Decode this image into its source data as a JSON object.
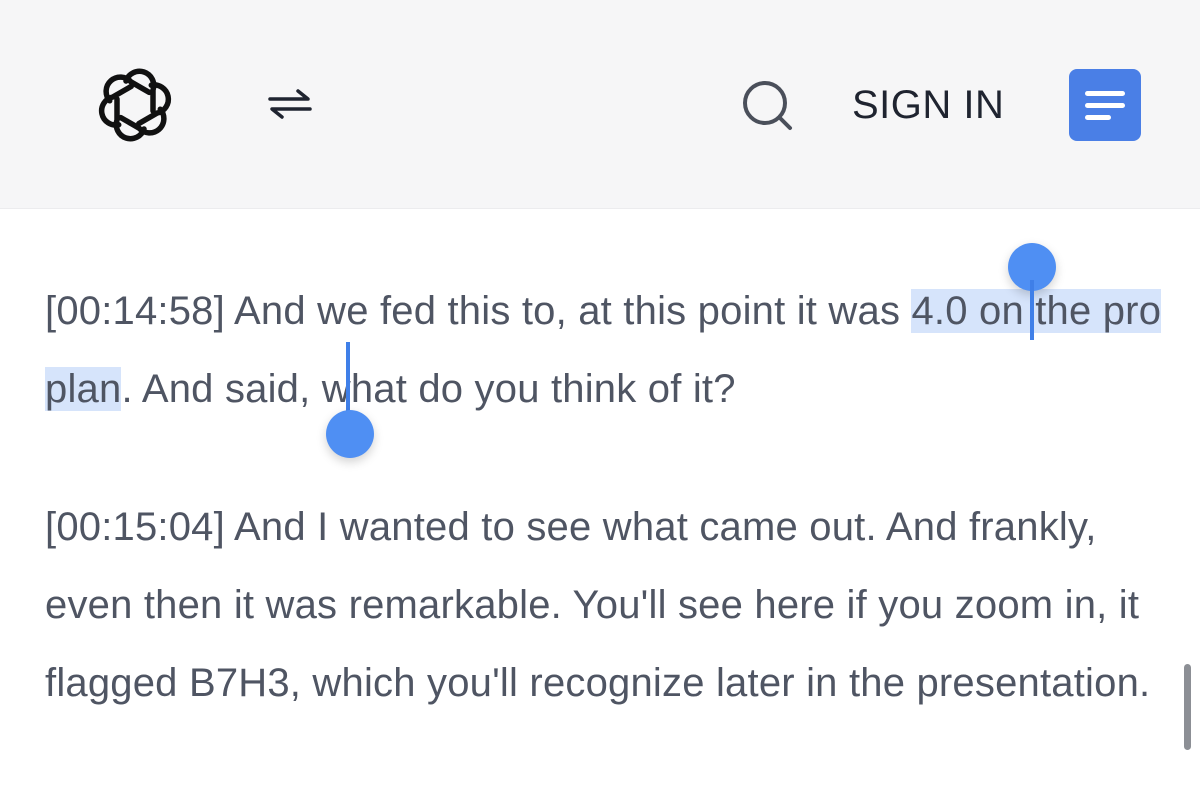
{
  "header": {
    "logo_icon": "openai-logo-icon",
    "switch_icon": "swap-arrows-icon",
    "search_icon": "search-icon",
    "signin_label": "SIGN IN",
    "menu_icon": "menu-icon",
    "menu_color": "#4a7fe6"
  },
  "transcript": {
    "p1": {
      "timestamp": "[00:14:58]",
      "before_selection": " And we fed this to, at this point it was ",
      "selected": "4.0 on the pro plan",
      "after_selection": ". And said, what do you think of it?"
    },
    "p2": {
      "timestamp": "[00:15:04]",
      "text": " And I wanted to see what came out. And frankly, even then it was remarkable. You'll see here if you zoom in, it flagged B7H3, which you'll recognize later in the presentation."
    }
  },
  "selection": {
    "highlight_color": "#d6e4fb",
    "handle_color": "#4f8ff3"
  }
}
